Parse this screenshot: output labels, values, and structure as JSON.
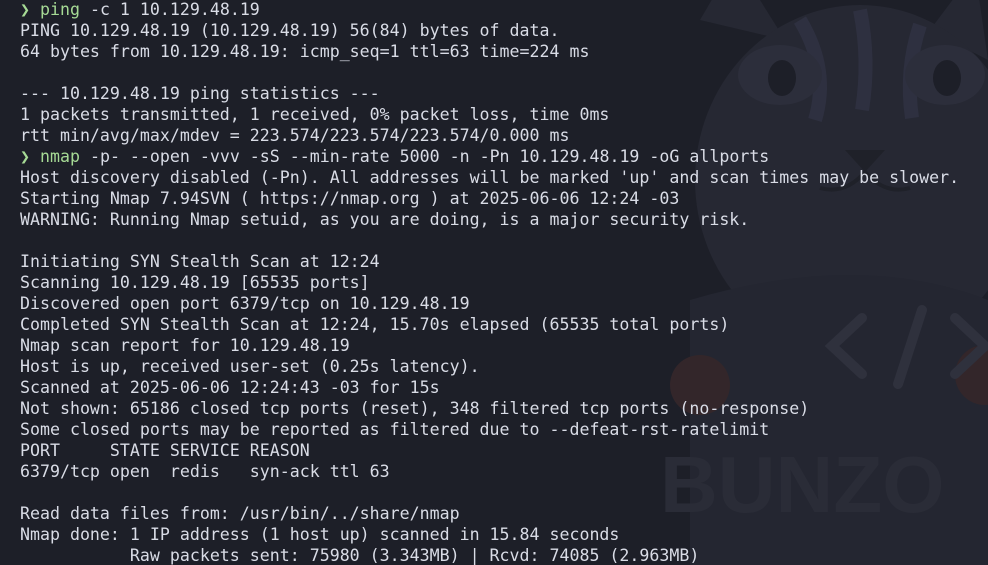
{
  "terminal": {
    "prompt_symbol": "❯",
    "colors": {
      "background": "#1d1f28",
      "text": "#d9dce6",
      "prompt": "#a6da95",
      "wallpaper_tint": "#2a2c37"
    },
    "wallpaper": {
      "icon": "cat-mascot-icon",
      "code_icon": "code-brackets-icon",
      "watermark_text": "BUNZO"
    },
    "lines": [
      {
        "type": "command",
        "cmd": "ping",
        "args": " -c 1 10.129.48.19"
      },
      {
        "type": "output",
        "text": "PING 10.129.48.19 (10.129.48.19) 56(84) bytes of data."
      },
      {
        "type": "output",
        "text": "64 bytes from 10.129.48.19: icmp_seq=1 ttl=63 time=224 ms"
      },
      {
        "type": "output",
        "text": ""
      },
      {
        "type": "output",
        "text": "--- 10.129.48.19 ping statistics ---"
      },
      {
        "type": "output",
        "text": "1 packets transmitted, 1 received, 0% packet loss, time 0ms"
      },
      {
        "type": "output",
        "text": "rtt min/avg/max/mdev = 223.574/223.574/223.574/0.000 ms"
      },
      {
        "type": "command",
        "cmd": "nmap",
        "args": " -p- --open -vvv -sS --min-rate 5000 -n -Pn 10.129.48.19 -oG allports"
      },
      {
        "type": "output",
        "text": "Host discovery disabled (-Pn). All addresses will be marked 'up' and scan times may be slower."
      },
      {
        "type": "output",
        "text": "Starting Nmap 7.94SVN ( https://nmap.org ) at 2025-06-06 12:24 -03"
      },
      {
        "type": "output",
        "text": "WARNING: Running Nmap setuid, as you are doing, is a major security risk."
      },
      {
        "type": "output",
        "text": ""
      },
      {
        "type": "output",
        "text": "Initiating SYN Stealth Scan at 12:24"
      },
      {
        "type": "output",
        "text": "Scanning 10.129.48.19 [65535 ports]"
      },
      {
        "type": "output",
        "text": "Discovered open port 6379/tcp on 10.129.48.19"
      },
      {
        "type": "output",
        "text": "Completed SYN Stealth Scan at 12:24, 15.70s elapsed (65535 total ports)"
      },
      {
        "type": "output",
        "text": "Nmap scan report for 10.129.48.19"
      },
      {
        "type": "output",
        "text": "Host is up, received user-set (0.25s latency)."
      },
      {
        "type": "output",
        "text": "Scanned at 2025-06-06 12:24:43 -03 for 15s"
      },
      {
        "type": "output",
        "text": "Not shown: 65186 closed tcp ports (reset), 348 filtered tcp ports (no-response)"
      },
      {
        "type": "output",
        "text": "Some closed ports may be reported as filtered due to --defeat-rst-ratelimit"
      },
      {
        "type": "output",
        "text": "PORT     STATE SERVICE REASON"
      },
      {
        "type": "output",
        "text": "6379/tcp open  redis   syn-ack ttl 63"
      },
      {
        "type": "output",
        "text": ""
      },
      {
        "type": "output",
        "text": "Read data files from: /usr/bin/../share/nmap"
      },
      {
        "type": "output",
        "text": "Nmap done: 1 IP address (1 host up) scanned in 15.84 seconds"
      },
      {
        "type": "output",
        "text": "           Raw packets sent: 75980 (3.343MB) | Rcvd: 74085 (2.963MB)"
      }
    ]
  }
}
